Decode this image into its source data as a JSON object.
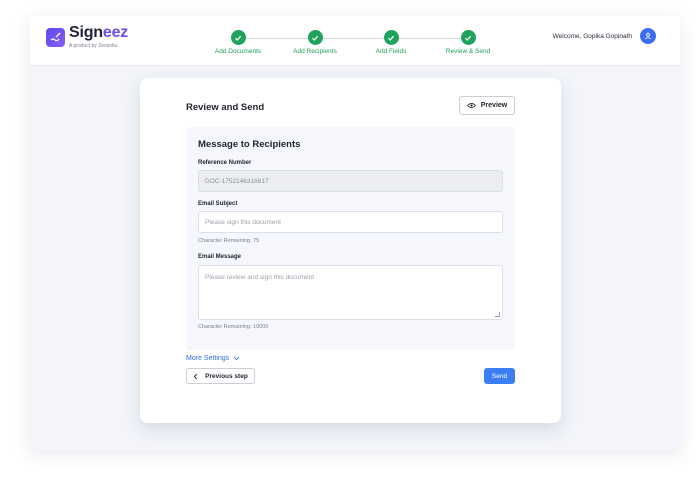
{
  "brand": {
    "name_prefix": "Sign",
    "name_suffix": "eez",
    "tagline": "A product by Zenzolia"
  },
  "steps": [
    {
      "label": "Add Documents",
      "status": "complete"
    },
    {
      "label": "Add Recipients",
      "status": "complete"
    },
    {
      "label": "Add Fields",
      "status": "complete"
    },
    {
      "label": "Review & Send",
      "status": "complete"
    }
  ],
  "user": {
    "welcome": "Welcome, Gopika Gopinath",
    "icon": "user-circle-icon"
  },
  "card": {
    "title": "Review and Send",
    "preview_label": "Preview",
    "panel_title": "Message to Recipients",
    "reference": {
      "label": "Reference Number",
      "value": "DOC-1752146316617"
    },
    "subject": {
      "label": "Email Subject",
      "placeholder": "Please sign this document",
      "hint": "Character Remaining: 75"
    },
    "message": {
      "label": "Email Message",
      "placeholder": "Please review and sign this document",
      "hint": "Character Remaining: 10000"
    },
    "more_settings": "More Settings",
    "previous_label": "Previous step",
    "send_label": "Send"
  },
  "colors": {
    "accent": "#3b7ef3",
    "success": "#1fa35c",
    "brand": "#6d4df2"
  }
}
